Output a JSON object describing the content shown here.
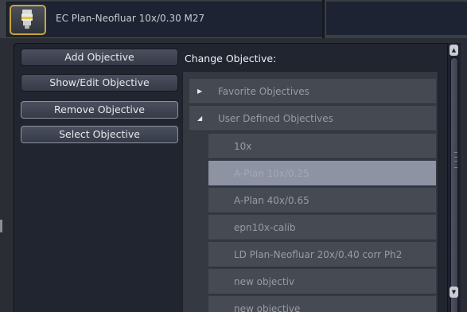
{
  "header": {
    "current_objective": "EC Plan-Neofluar 10x/0.30 M27",
    "objective_icon": "objective-lens-icon"
  },
  "actions": {
    "add": "Add Objective",
    "show_edit": "Show/Edit Objective",
    "remove": "Remove Objective",
    "select": "Select Objective"
  },
  "change_label": "Change Objective:",
  "tree": {
    "groups": [
      {
        "label": "Favorite Objectives",
        "expanded": false,
        "caret_icon": "triangle-right-icon"
      },
      {
        "label": "User Defined Objectives",
        "expanded": true,
        "caret_icon": "triangle-down-icon"
      }
    ],
    "items": [
      {
        "label": "10x",
        "selected": false
      },
      {
        "label": "A-Plan 10x/0.25",
        "selected": true
      },
      {
        "label": "A-Plan 40x/0.65",
        "selected": false
      },
      {
        "label": "epn10x-calib",
        "selected": false
      },
      {
        "label": "LD Plan-Neofluar 20x/0.40 corr Ph2",
        "selected": false
      },
      {
        "label": "new objectiv",
        "selected": false
      },
      {
        "label": "new objective",
        "selected": false
      }
    ]
  },
  "scrollbar": {
    "up_icon": "arrow-up-icon",
    "down_icon": "arrow-down-icon"
  },
  "colors": {
    "panel_bg": "#20252f",
    "accent_border": "#c8a53a",
    "selected_row": "#8e93a4"
  }
}
